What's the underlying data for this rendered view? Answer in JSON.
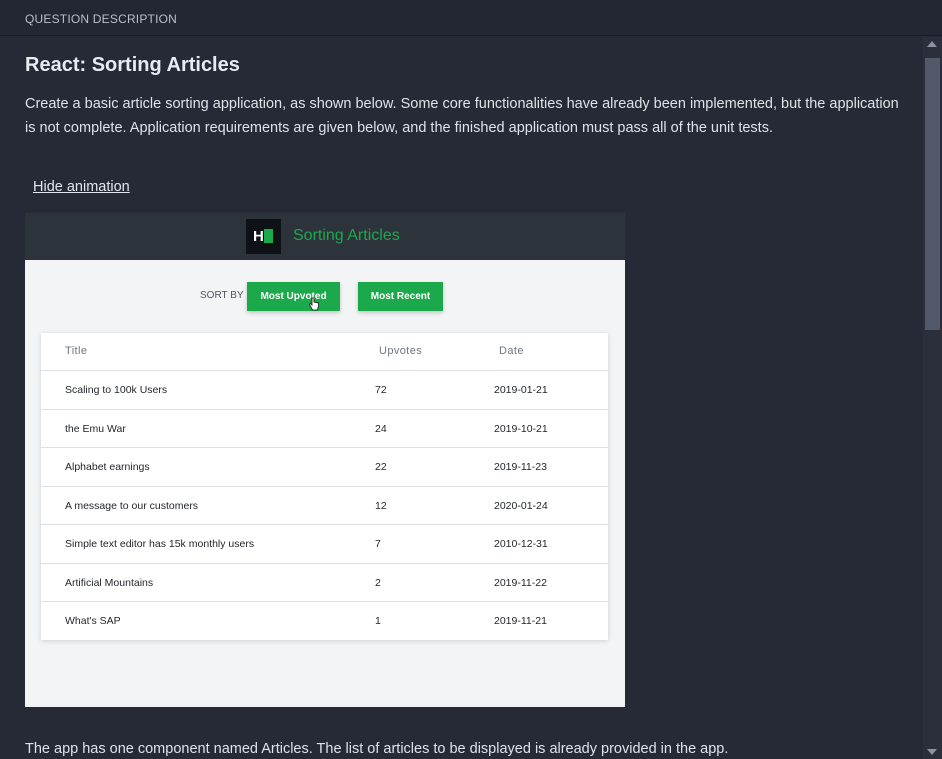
{
  "header": {
    "label": "QUESTION DESCRIPTION"
  },
  "question": {
    "title": "React: Sorting Articles",
    "intro": "Create a basic article sorting application, as shown below. Some core functionalities have already been implemented, but the application is not complete. Application requirements are given below, and the finished application must pass all of the unit tests.",
    "hide_animation_label": "Hide animation",
    "outro": "The app has one component named Articles. The list of articles to be displayed is already provided in the app."
  },
  "demo": {
    "logo_letter": "H",
    "app_title": "Sorting Articles",
    "sort_by_label": "SORT BY",
    "most_upvoted_label": "Most Upvoted",
    "most_recent_label": "Most Recent",
    "columns": {
      "title": "Title",
      "upvotes": "Upvotes",
      "date": "Date"
    },
    "articles": [
      {
        "title": "Scaling to 100k Users",
        "upvotes": "72",
        "date": "2019-01-21"
      },
      {
        "title": "the Emu War",
        "upvotes": "24",
        "date": "2019-10-21"
      },
      {
        "title": "Alphabet earnings",
        "upvotes": "22",
        "date": "2019-11-23"
      },
      {
        "title": "A message to our customers",
        "upvotes": "12",
        "date": "2020-01-24"
      },
      {
        "title": "Simple text editor has 15k monthly users",
        "upvotes": "7",
        "date": "2010-12-31"
      },
      {
        "title": "Artificial Mountains",
        "upvotes": "2",
        "date": "2019-11-22"
      },
      {
        "title": "What's SAP",
        "upvotes": "1",
        "date": "2019-11-21"
      }
    ]
  },
  "colors": {
    "background": "#252a36",
    "accent": "#1ba94c",
    "demo_header": "#2d333b"
  },
  "icons": {
    "scroll_up": "chevron-up-icon",
    "scroll_down": "chevron-down-icon",
    "cursor": "hand-pointer-icon"
  }
}
